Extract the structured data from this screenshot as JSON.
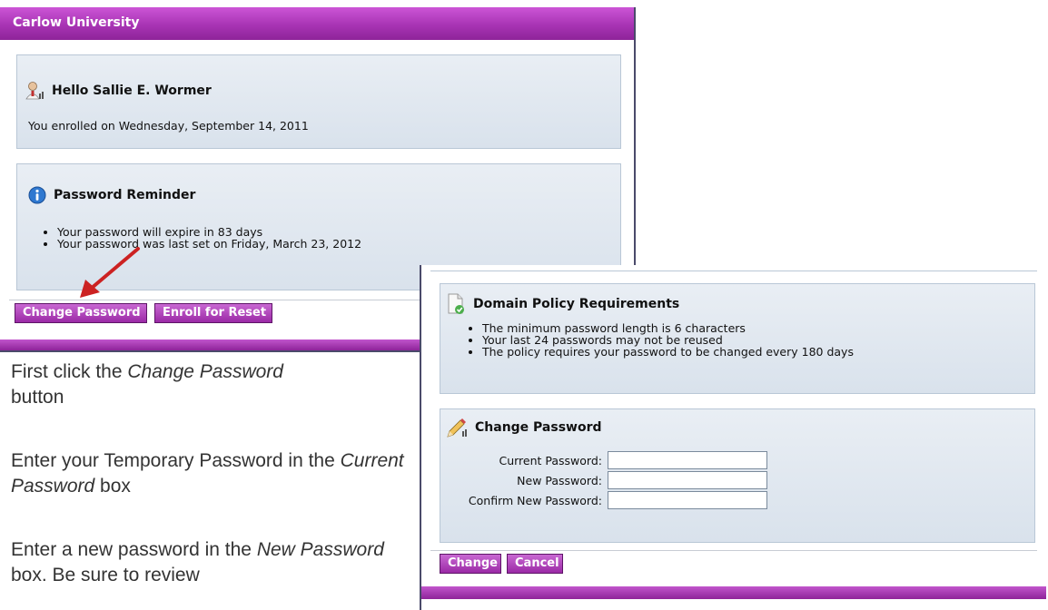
{
  "window_main": {
    "title": "Carlow University",
    "greeting": "Hello Sallie E. Wormer",
    "enrolled_text": "You enrolled on Wednesday, September 14, 2011",
    "reminder": {
      "title": "Password Reminder",
      "items": [
        "Your password will expire in 83 days",
        "Your password was last set on Friday, March 23, 2012"
      ]
    },
    "buttons": {
      "change_password": "Change Password",
      "enroll_reset": "Enroll for Reset"
    }
  },
  "instructions": {
    "step1": {
      "prefix": "First click the ",
      "emph": "Change Password",
      "suffix": " button"
    },
    "step2": {
      "prefix": "Enter your Temporary Password in the ",
      "emph": "Current Password",
      "suffix": " box"
    },
    "step3": {
      "prefix": "Enter a new password in the ",
      "emph": "New Password",
      "suffix": " box.  Be sure to review"
    }
  },
  "window_change": {
    "policy": {
      "title": "Domain Policy Requirements",
      "items": [
        "The minimum password length is 6 characters",
        "Your last 24 passwords may not be reused",
        "The policy requires your password to be changed every 180 days"
      ]
    },
    "form": {
      "title": "Change Password",
      "current_label": "Current Password:",
      "new_label": "New Password:",
      "confirm_label": "Confirm New Password:",
      "current_value": "",
      "new_value": "",
      "confirm_value": ""
    },
    "buttons": {
      "change": "Change",
      "cancel": "Cancel"
    }
  },
  "colors": {
    "accent": "#a834b4",
    "panel": "#dfe7ef",
    "arrow": "#cc2222"
  }
}
